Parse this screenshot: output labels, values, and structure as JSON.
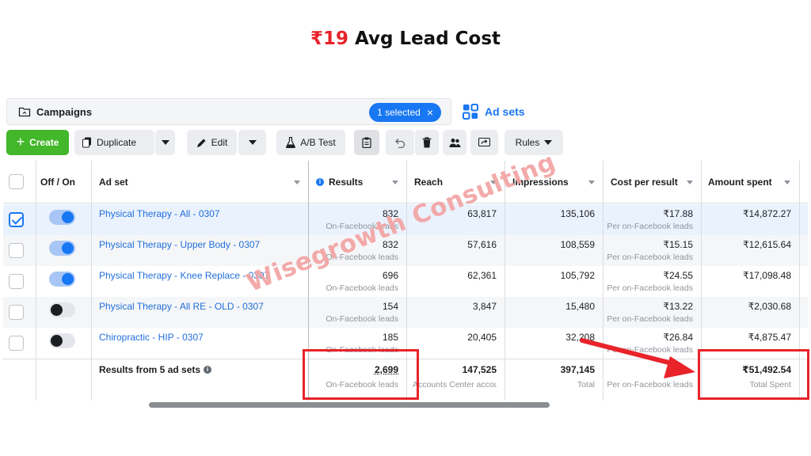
{
  "headline": {
    "currency_value": "₹19",
    "rest": "Avg Lead Cost"
  },
  "topbar": {
    "campaigns_label": "Campaigns",
    "selected_label": "1 selected",
    "selected_close": "×",
    "adsets_label": "Ad sets"
  },
  "toolbar": {
    "create_label": "Create",
    "duplicate_label": "Duplicate",
    "edit_label": "Edit",
    "abtest_label": "A/B Test",
    "rules_label": "Rules"
  },
  "table": {
    "headers": {
      "offon": "Off / On",
      "adset": "Ad set",
      "results": "Results",
      "reach": "Reach",
      "impressions": "Impressions",
      "cpr": "Cost per result",
      "amount": "Amount spent"
    },
    "rows": [
      {
        "selected": true,
        "on": true,
        "name": "Physical Therapy - All - 0307",
        "results": "832",
        "results_sub": "On-Facebook leads",
        "reach": "63,817",
        "impressions": "135,106",
        "cpr": "₹17.88",
        "cpr_sub": "Per on-Facebook leads",
        "amount": "₹14,872.27"
      },
      {
        "selected": false,
        "on": true,
        "name": "Physical Therapy - Upper Body - 0307",
        "results": "832",
        "results_sub": "On-Facebook leads",
        "reach": "57,616",
        "impressions": "108,559",
        "cpr": "₹15.15",
        "cpr_sub": "Per on-Facebook leads",
        "amount": "₹12,615.64"
      },
      {
        "selected": false,
        "on": true,
        "name": "Physical Therapy - Knee Replace - 0307",
        "results": "696",
        "results_sub": "On-Facebook leads",
        "reach": "62,361",
        "impressions": "105,792",
        "cpr": "₹24.55",
        "cpr_sub": "Per on-Facebook leads",
        "amount": "₹17,098.48"
      },
      {
        "selected": false,
        "on": false,
        "name": "Physical Therapy - All RE - OLD - 0307",
        "results": "154",
        "results_sub": "On-Facebook leads",
        "reach": "3,847",
        "impressions": "15,480",
        "cpr": "₹13.22",
        "cpr_sub": "Per on-Facebook leads",
        "amount": "₹2,030.68"
      },
      {
        "selected": false,
        "on": false,
        "name": "Chiropractic - HIP - 0307",
        "results": "185",
        "results_sub": "On-Facebook leads",
        "reach": "20,405",
        "impressions": "32,208",
        "cpr": "₹26.84",
        "cpr_sub": "Per on-Facebook leads",
        "amount": "₹4,875.47"
      }
    ],
    "footer": {
      "label": "Results from 5 ad sets",
      "results": "2,699",
      "results_sub": "On-Facebook leads",
      "reach": "147,525",
      "reach_sub": "Accounts Center accounts",
      "impressions": "397,145",
      "impressions_sub": "Total",
      "cpr_sub": "Per on-Facebook leads",
      "amount": "₹51,492.54",
      "amount_sub": "Total Spent"
    }
  },
  "watermark": "Wisegrowth Consulting",
  "colors": {
    "accent_red": "#e8232a",
    "fb_blue": "#1877f2",
    "create_green": "#42b72a",
    "watermark": "#f3a3a3"
  }
}
